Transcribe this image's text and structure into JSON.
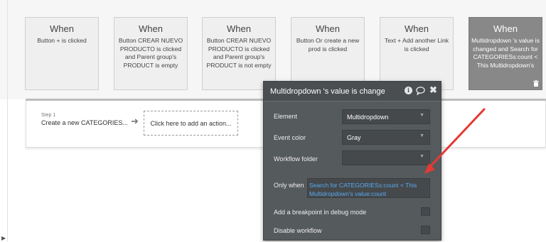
{
  "events": [
    {
      "title": "When",
      "description": "Button + is clicked",
      "active": false
    },
    {
      "title": "When",
      "description": "Button CREAR NUEVO PRODUCTO is clicked and Parent group's PRODUCT is empty",
      "active": false
    },
    {
      "title": "When",
      "description": "Button CREAR NUEVO PRODUCTO is clicked and Parent group's PRODUCT is not empty",
      "active": false
    },
    {
      "title": "When",
      "description": "Button Or create a new prod is clicked",
      "active": false
    },
    {
      "title": "When",
      "description": "Text + Add another Link is clicked",
      "active": false
    },
    {
      "title": "When",
      "description": "Multidropdown 's value is changed and Search for CATEGORIESs:count < This Multidropdown's",
      "active": true
    }
  ],
  "step": {
    "label": "Step 1",
    "title": "Create a new CATEGORIES...",
    "add_action": "Click here to add an action..."
  },
  "panel": {
    "title": "Multidropdown 's value is change",
    "element_label": "Element",
    "element_value": "Multidropdown",
    "event_color_label": "Event color",
    "event_color_value": "Gray",
    "workflow_folder_label": "Workflow folder",
    "workflow_folder_value": "",
    "only_when_label": "Only when",
    "only_when_value": "Search for CATEGORIESs:count < This Multidropdown's value:count",
    "breakpoint_label": "Add a breakpoint in debug mode",
    "breakpoint_checked": false,
    "disable_label": "Disable workflow",
    "disable_checked": false
  },
  "icons": {
    "info": "info-icon",
    "comment": "comment-icon",
    "close": "close-icon",
    "trash": "trash-icon",
    "chevron": "chevron-down-icon"
  },
  "colors": {
    "panel_bg": "#555a5d",
    "condition_text": "#5aa9f0",
    "annotation_arrow": "#e53935",
    "active_card": "#888888"
  }
}
